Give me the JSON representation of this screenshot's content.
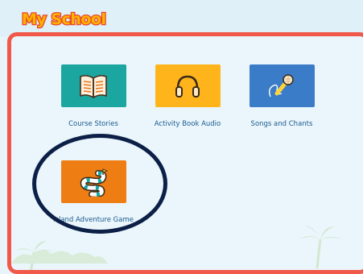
{
  "header": {
    "title": "My School"
  },
  "tiles": [
    {
      "label": "Course Stories",
      "icon": "open-book-icon",
      "color": "#1ba6a0"
    },
    {
      "label": "Activity Book Audio",
      "icon": "headphones-icon",
      "color": "#ffb41b"
    },
    {
      "label": "Songs and Chants",
      "icon": "microphone-icon",
      "color": "#3a7cc7"
    },
    {
      "label": "Island Adventure Game",
      "icon": "board-game-path-icon",
      "color": "#ee7d14"
    }
  ],
  "colors": {
    "panel_border": "#f0584a",
    "title_fill": "#ffb300",
    "title_outline": "#e8462a",
    "label_text": "#1b5a91",
    "highlight_ring": "#0c1f46"
  }
}
